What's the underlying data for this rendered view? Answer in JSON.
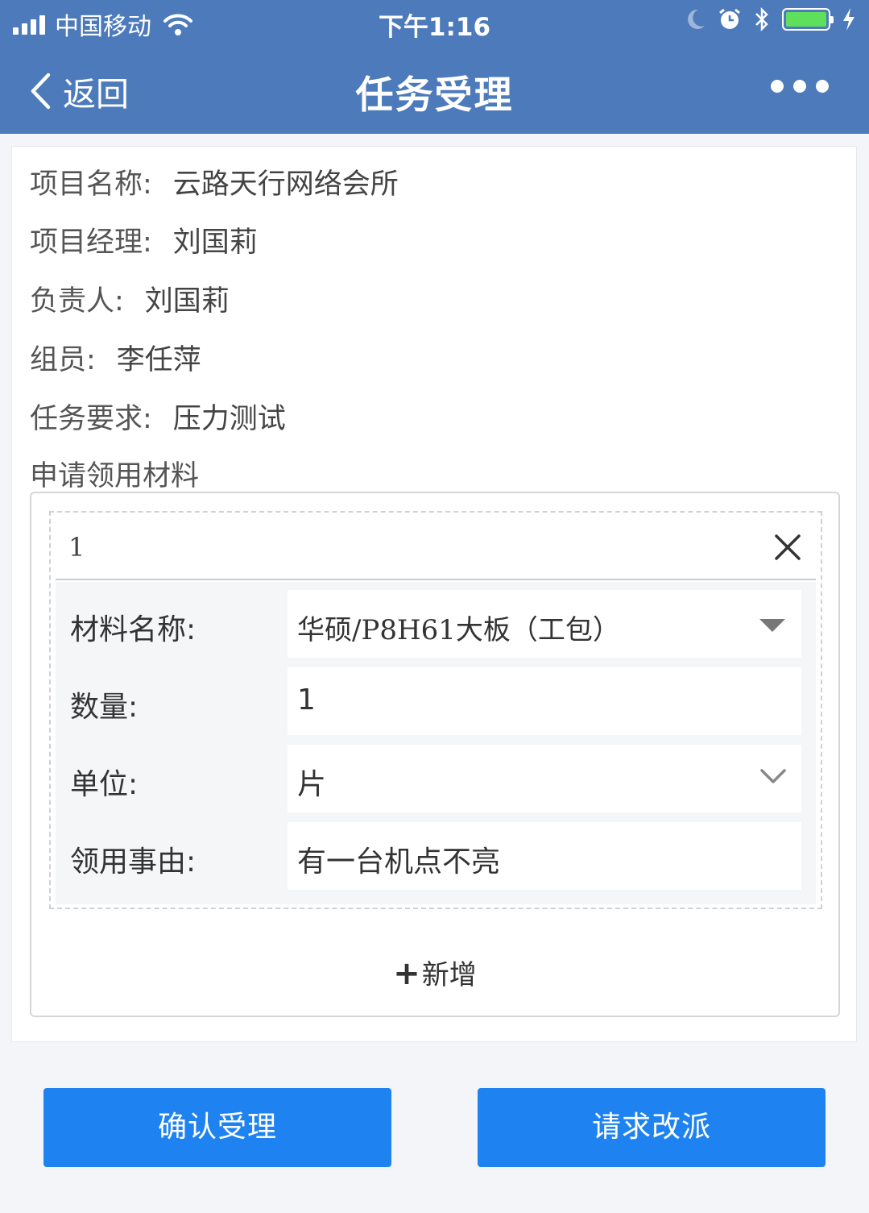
{
  "status_bar": {
    "carrier": "中国移动",
    "time": "下午1:16"
  },
  "nav": {
    "back_label": "返回",
    "title": "任务受理"
  },
  "info": {
    "project_name_label": "项目名称:",
    "project_name": "云路天行网络会所",
    "manager_label": "项目经理:",
    "manager": "刘国莉",
    "owner_label": "负责人:",
    "owner": "刘国莉",
    "members_label": "组员:",
    "members": "李任萍",
    "requirement_label": "任务要求:",
    "requirement": "压力测试"
  },
  "materials": {
    "section_title": "申请领用材料",
    "items": [
      {
        "index": "1",
        "name_label": "材料名称:",
        "name_value": "华硕/P8H61大板（工包）",
        "qty_label": "数量:",
        "qty_value": "1",
        "unit_label": "单位:",
        "unit_value": "片",
        "reason_label": "领用事由:",
        "reason_value": "有一台机点不亮"
      }
    ],
    "add_label": "新增"
  },
  "actions": {
    "confirm_label": "确认受理",
    "reassign_label": "请求改派"
  },
  "colors": {
    "header_bg": "#4c7abb",
    "button_bg": "#1e83f0",
    "page_bg": "#f4f5f9"
  }
}
